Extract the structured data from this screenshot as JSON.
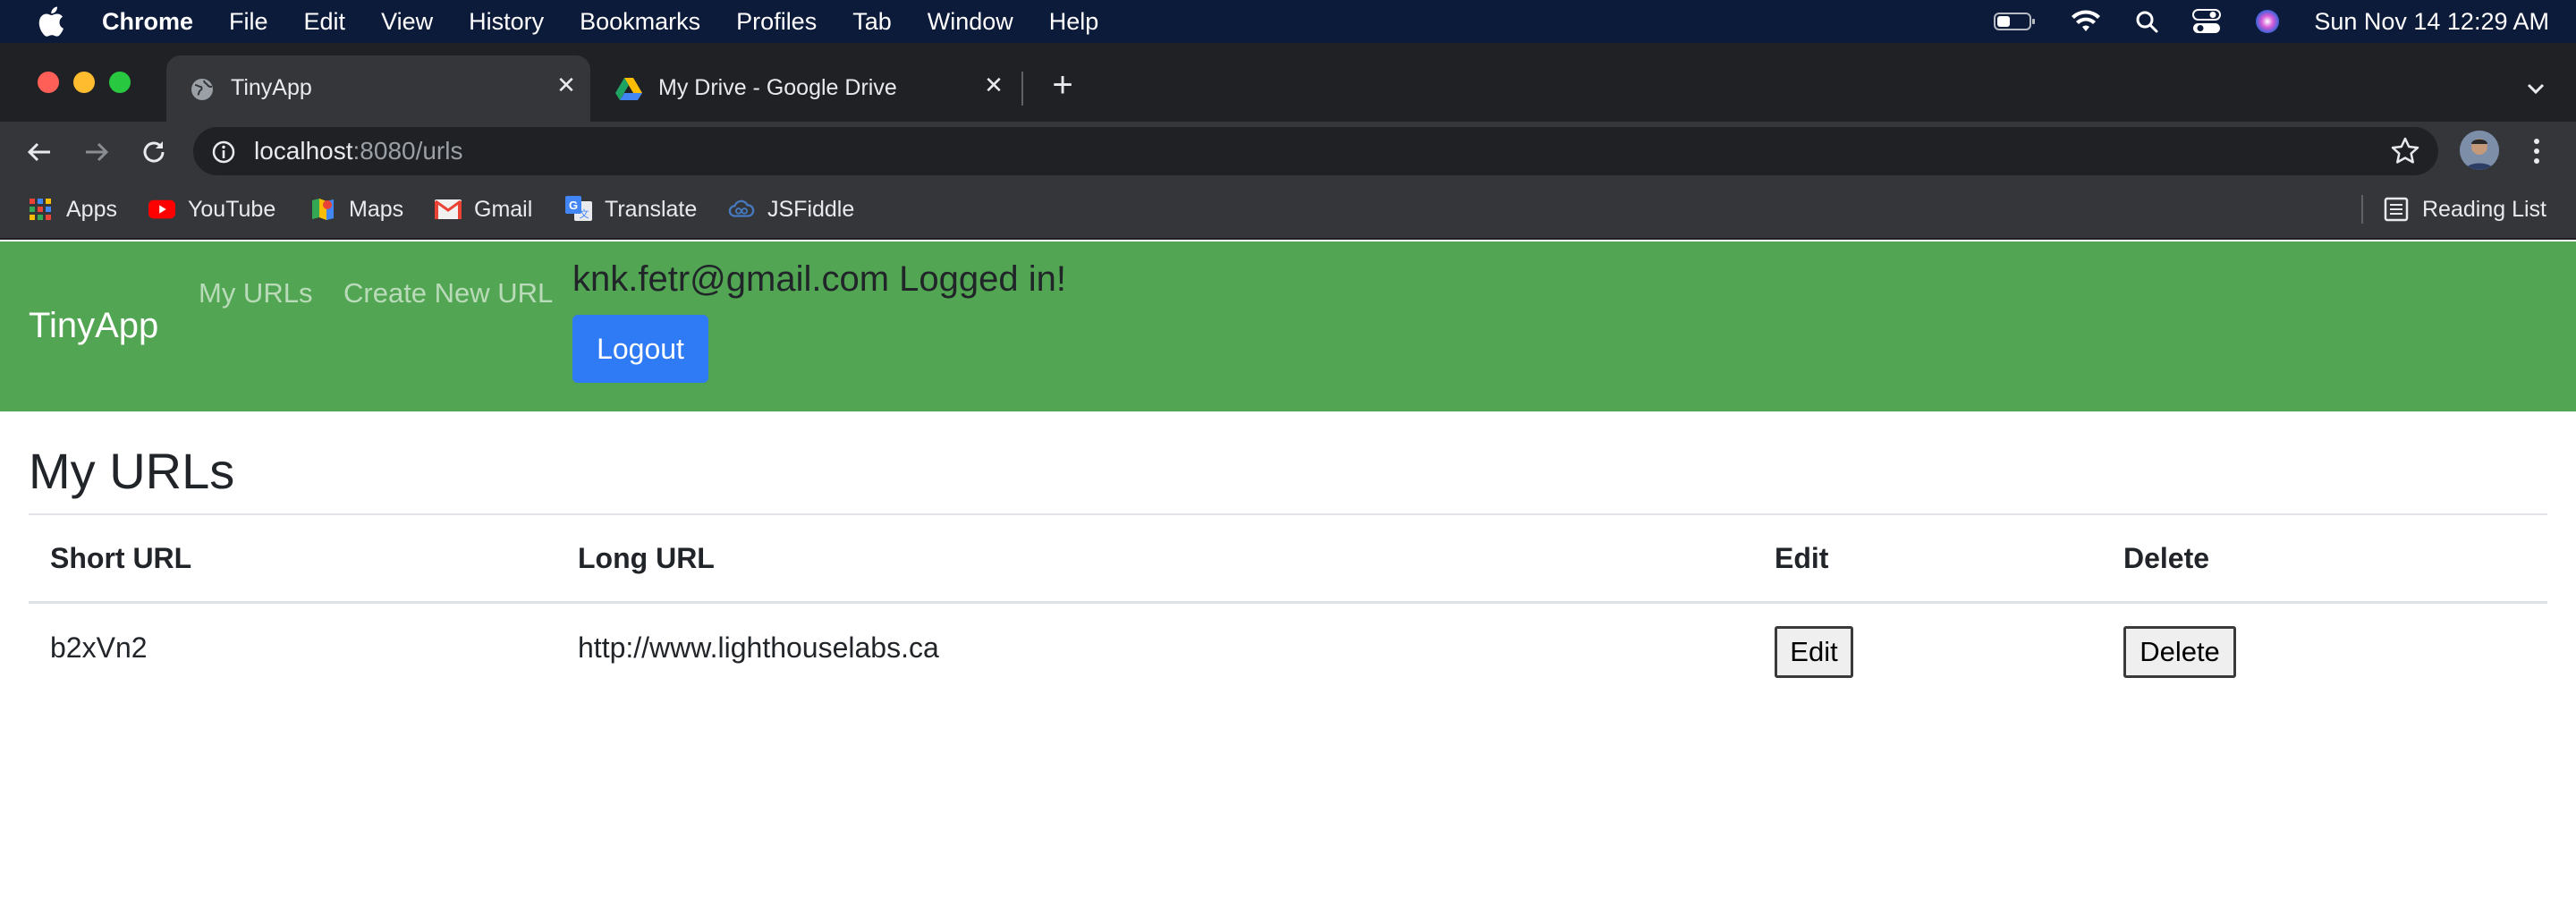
{
  "menubar": {
    "app_name": "Chrome",
    "menus": [
      "File",
      "Edit",
      "View",
      "History",
      "Bookmarks",
      "Profiles",
      "Tab",
      "Window",
      "Help"
    ],
    "clock": "Sun Nov 14  12:29 AM"
  },
  "tabs": [
    {
      "title": "TinyApp",
      "active": true,
      "icon": "globe-icon"
    },
    {
      "title": "My Drive - Google Drive",
      "active": false,
      "icon": "google-drive-icon"
    }
  ],
  "address_bar": {
    "host": "localhost",
    "path": ":8080/urls"
  },
  "bookmarks": [
    {
      "label": "Apps",
      "icon": "apps-grid-icon"
    },
    {
      "label": "YouTube",
      "icon": "youtube-icon"
    },
    {
      "label": "Maps",
      "icon": "maps-icon"
    },
    {
      "label": "Gmail",
      "icon": "gmail-icon"
    },
    {
      "label": "Translate",
      "icon": "translate-icon"
    },
    {
      "label": "JSFiddle",
      "icon": "jsfiddle-icon"
    }
  ],
  "reading_list": "Reading List",
  "page": {
    "brand": "TinyApp",
    "nav_links": [
      "My URLs",
      "Create New URL"
    ],
    "login_message": "knk.fetr@gmail.com Logged in!",
    "logout_label": "Logout",
    "heading": "My URLs",
    "table": {
      "headers": [
        "Short URL",
        "Long URL",
        "Edit",
        "Delete"
      ],
      "rows": [
        {
          "short_url": "b2xVn2",
          "long_url": "http://www.lighthouselabs.ca",
          "edit_label": "Edit",
          "delete_label": "Delete"
        }
      ]
    }
  },
  "colors": {
    "navbar": "#52a552",
    "logout_button": "#2f7bf6",
    "chrome_frame": "#202124",
    "chrome_toolbar": "#35363a",
    "menubar": "#0d1b3a"
  }
}
